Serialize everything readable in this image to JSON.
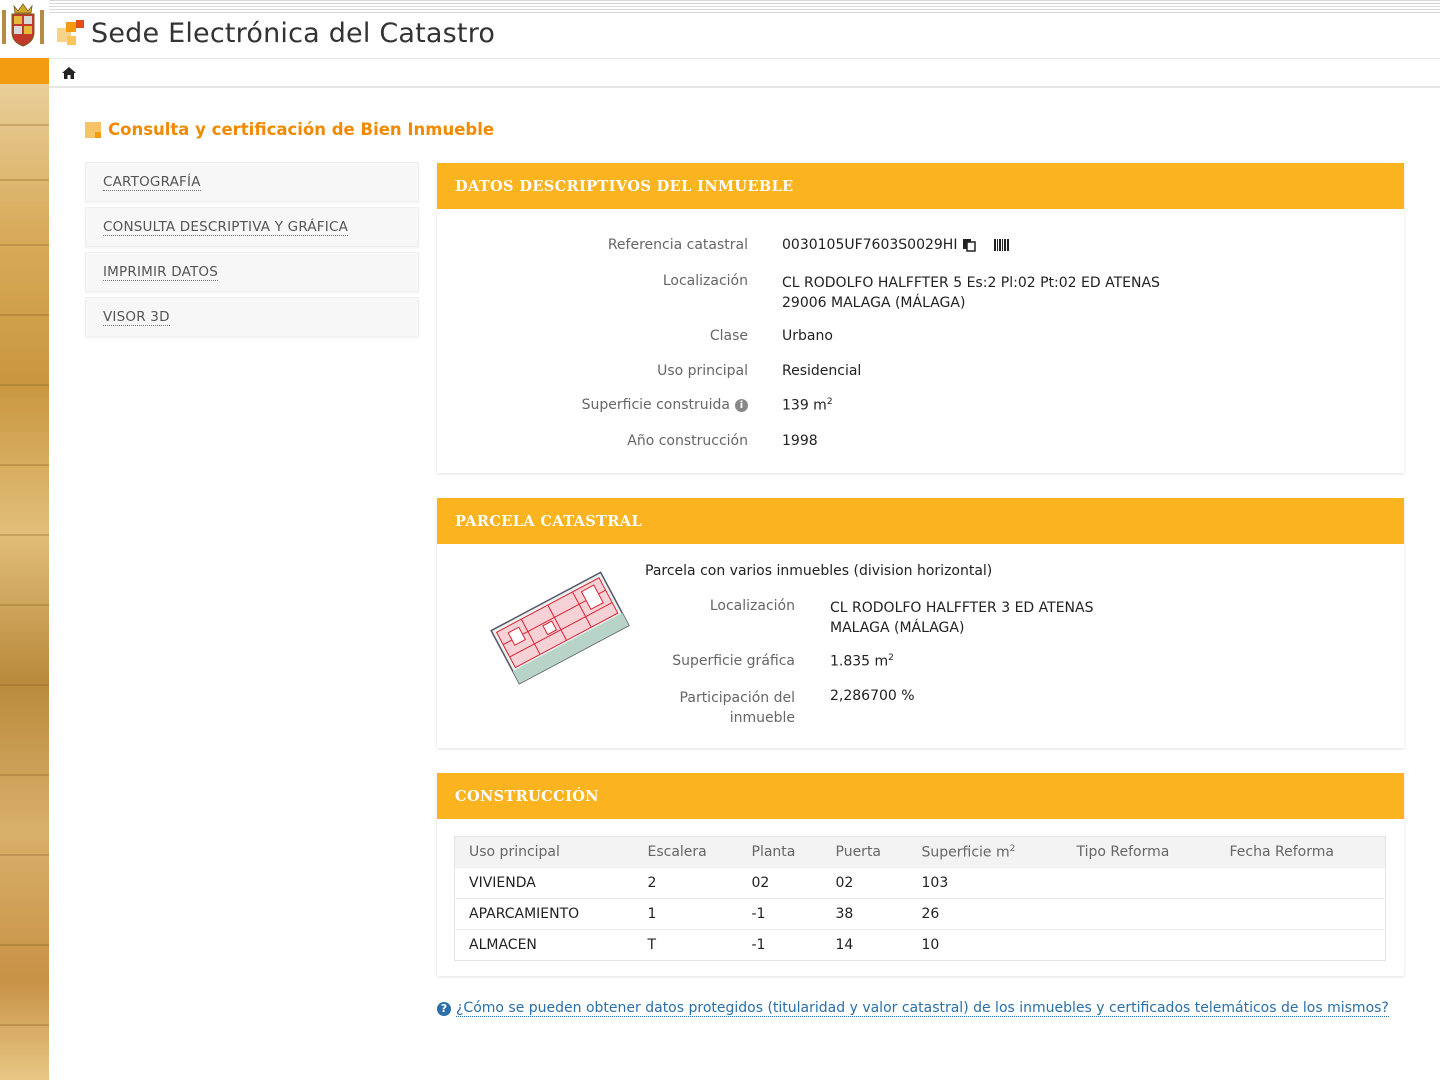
{
  "header": {
    "site_title": "Sede Electrónica del Catastro"
  },
  "page_heading": "Consulta y certificación de Bien Inmueble",
  "side_menu": [
    {
      "label": "CARTOGRAFÍA"
    },
    {
      "label": "CONSULTA DESCRIPTIVA Y GRÁFICA"
    },
    {
      "label": "IMPRIMIR DATOS"
    },
    {
      "label": "VISOR 3D"
    }
  ],
  "datos": {
    "title": "DATOS DESCRIPTIVOS DEL INMUEBLE",
    "referencia_label": "Referencia catastral",
    "referencia_value": "0030105UF7603S0029HI",
    "localizacion_label": "Localización",
    "localizacion_line1": "CL RODOLFO HALFFTER 5 Es:2 Pl:02 Pt:02 ED ATENAS",
    "localizacion_line2": "29006 MALAGA (MÁLAGA)",
    "clase_label": "Clase",
    "clase_value": "Urbano",
    "uso_label": "Uso principal",
    "uso_value": "Residencial",
    "superficie_label": "Superficie construida",
    "superficie_value": "139 m",
    "superficie_exp": "2",
    "anio_label": "Año construcción",
    "anio_value": "1998"
  },
  "parcela": {
    "title": "PARCELA CATASTRAL",
    "subtitle": "Parcela con varios inmuebles (division horizontal)",
    "localizacion_label": "Localización",
    "localizacion_line1": "CL RODOLFO HALFFTER 3 ED ATENAS",
    "localizacion_line2": "MALAGA (MÁLAGA)",
    "superficie_label": "Superficie gráfica",
    "superficie_value": "1.835 m",
    "superficie_exp": "2",
    "participacion_label_1": "Participación del",
    "participacion_label_2": "inmueble",
    "participacion_value": "2,286700 %"
  },
  "construccion": {
    "title": "CONSTRUCCIÓN",
    "headers": [
      "Uso principal",
      "Escalera",
      "Planta",
      "Puerta",
      "Superficie m",
      "Tipo Reforma",
      "Fecha Reforma"
    ],
    "superficie_header_exp": "2",
    "rows": [
      [
        "VIVIENDA",
        "2",
        "02",
        "02",
        "103",
        "",
        ""
      ],
      [
        "APARCAMIENTO",
        "1",
        "-1",
        "38",
        "26",
        "",
        ""
      ],
      [
        "ALMACEN",
        "T",
        "-1",
        "14",
        "10",
        "",
        ""
      ]
    ]
  },
  "faq_link": "¿Cómo se pueden obtener datos protegidos (titularidad y valor catastral) de los inmuebles y certificados telemáticos de los mismos?",
  "colors": {
    "accent": "#fbb41f",
    "heading": "#f08a00",
    "link": "#2a6fa8"
  }
}
